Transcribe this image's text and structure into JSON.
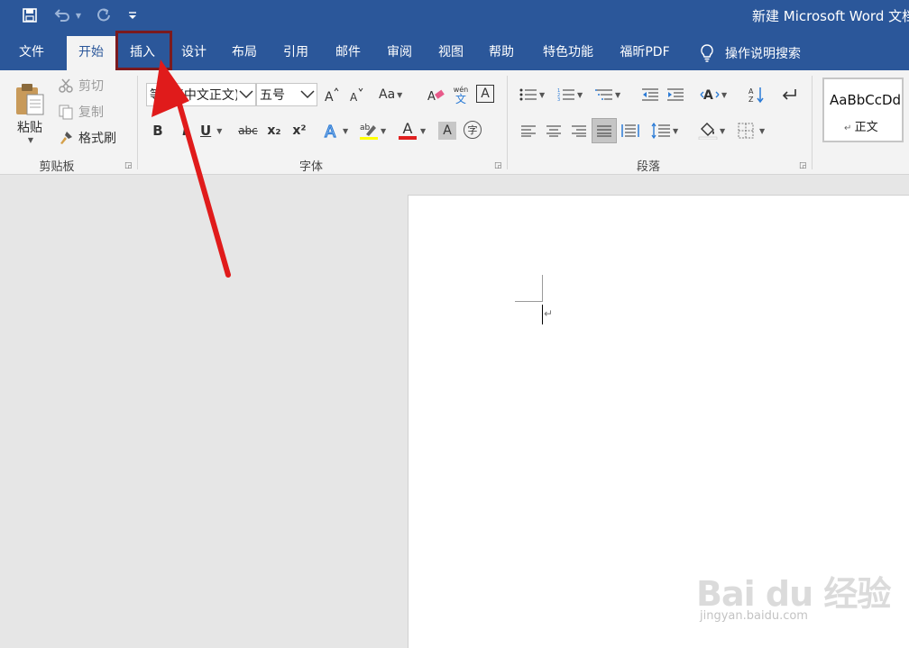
{
  "window": {
    "title": "新建 Microsoft Word 文档"
  },
  "quick_access": {
    "save_icon": "save-icon",
    "undo_icon": "undo-icon",
    "redo_icon": "redo-icon",
    "customize_icon": "customize-qat-icon"
  },
  "tabs": [
    {
      "label": "文件",
      "active": false
    },
    {
      "label": "开始",
      "active": true
    },
    {
      "label": "插入",
      "active": false
    },
    {
      "label": "设计",
      "active": false
    },
    {
      "label": "布局",
      "active": false
    },
    {
      "label": "引用",
      "active": false
    },
    {
      "label": "邮件",
      "active": false
    },
    {
      "label": "审阅",
      "active": false
    },
    {
      "label": "视图",
      "active": false
    },
    {
      "label": "帮助",
      "active": false
    },
    {
      "label": "特色功能",
      "active": false
    },
    {
      "label": "福昕PDF",
      "active": false
    }
  ],
  "tell_me": {
    "label": "操作说明搜索",
    "icon": "lightbulb-icon"
  },
  "ribbon": {
    "clipboard": {
      "group_label": "剪贴板",
      "paste_label": "粘贴",
      "cut_label": "剪切",
      "copy_label": "复制",
      "format_painter_label": "格式刷"
    },
    "font": {
      "group_label": "字体",
      "font_name": "等线 (中文正文)",
      "font_size": "五号",
      "bold": "B",
      "italic": "I",
      "underline": "U",
      "strikethrough": "abc",
      "subscript": "x₂",
      "superscript": "x²",
      "change_case": "Aa",
      "phonetic_top": "wén",
      "phonetic_bottom": "文",
      "char_border": "A",
      "font_color_letter": "A",
      "shading_letter": "A",
      "enclose_char": "字",
      "font_color": "#e02020"
    },
    "paragraph": {
      "group_label": "段落"
    },
    "styles": {
      "sample_text": "AaBbCcDd",
      "style_name": "正文"
    }
  },
  "watermark": {
    "logo": "Bai du 经验",
    "url": "jingyan.baidu.com"
  },
  "annotation": {
    "highlight_color": "#7b1a1e",
    "arrow_color": "#e01b1b"
  }
}
